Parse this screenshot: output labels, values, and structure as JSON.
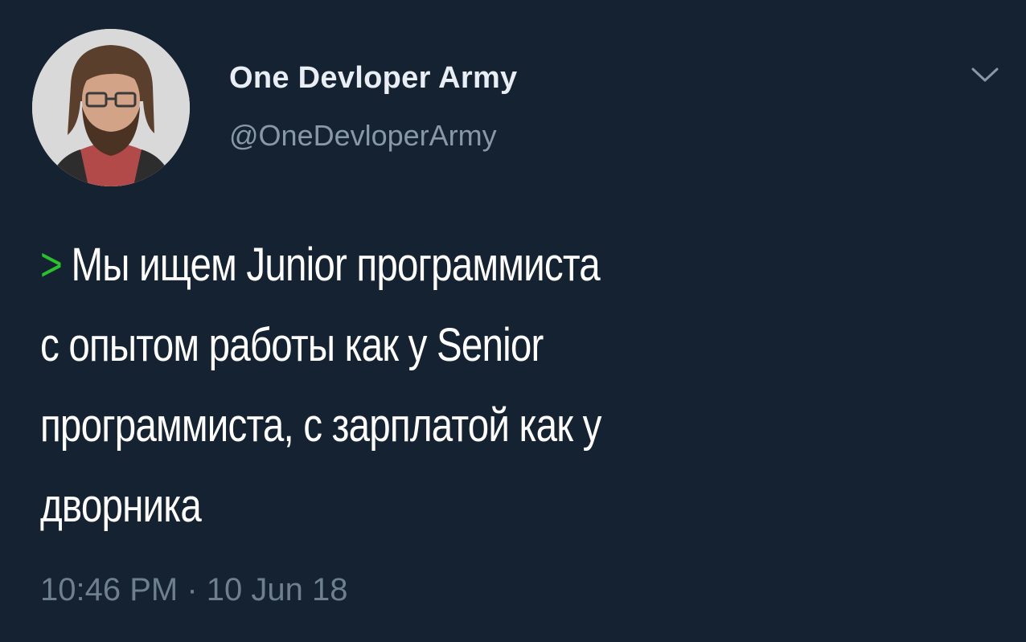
{
  "colors": {
    "background": "#152232",
    "display_name": "#e8eef3",
    "handle": "#8899a6",
    "body_text": "#ffffff",
    "quote_mark": "#29c12e",
    "timestamp": "#6e7f8e"
  },
  "author": {
    "display_name": "One Devloper Army",
    "handle": "@OneDevloperArmy",
    "avatar_icon": "user-avatar-photo"
  },
  "menu": {
    "icon": "chevron-down-icon"
  },
  "tweet": {
    "quote_mark": ">",
    "lines": [
      "Мы ищем Junior программиста",
      "с опытом работы как у Senior",
      "программиста, с зарплатой как у",
      "дворника"
    ],
    "timestamp": "10:46 PM · 10 Jun 18"
  }
}
